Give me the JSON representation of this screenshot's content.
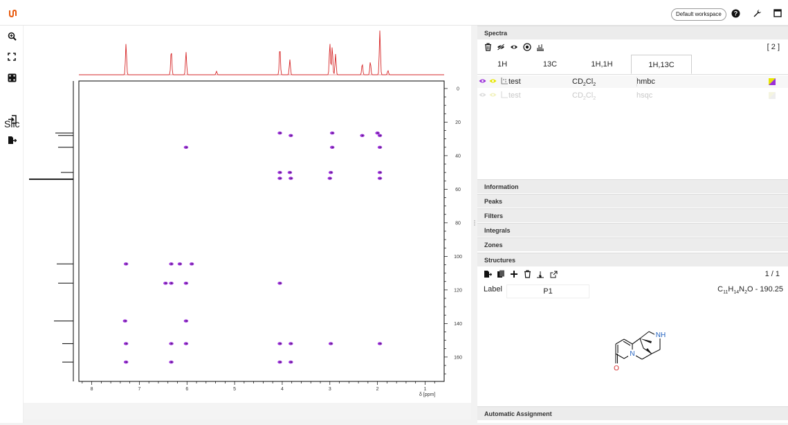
{
  "topbar": {
    "workspace_label": "Default workspace",
    "icons": [
      "help-icon",
      "wrench-icon",
      "maximize-icon"
    ]
  },
  "toolbar": {
    "slice_label": "Slic",
    "icons": [
      "zoom-icon",
      "full-view-icon",
      "dice-icon",
      "import-icon",
      "export-icon"
    ]
  },
  "colors": {
    "accent": "#e8590c",
    "spectrum_red": "#d62728",
    "contour_purple": "#9b30d9",
    "contour_yellow": "#e6e600",
    "nitrogen_blue": "#1f5fbf",
    "oxygen_red": "#d42a2a"
  },
  "spectra": {
    "header": "Spectra",
    "count": "[ 2 ]",
    "tabs": [
      {
        "label": "1H",
        "active": false
      },
      {
        "label": "13C",
        "active": false
      },
      {
        "label": "1H,1H",
        "active": false
      },
      {
        "label": "1H,13C",
        "active": true
      }
    ],
    "rows": [
      {
        "name": "test",
        "solvent": "CD",
        "sol_sub1": "2",
        "sol_mid": "Cl",
        "sol_sub2": "2",
        "experiment": "hmbc",
        "active": true
      },
      {
        "name": "test",
        "solvent": "CD",
        "sol_sub1": "2",
        "sol_mid": "Cl",
        "sol_sub2": "2",
        "experiment": "hsqc",
        "active": false
      }
    ]
  },
  "sections": {
    "information": "Information",
    "peaks": "Peaks",
    "filters": "Filters",
    "integrals": "Integrals",
    "zones": "Zones",
    "structures": "Structures",
    "automatic_assignment": "Automatic Assignment"
  },
  "structures": {
    "page": "1 / 1",
    "label_caption": "Label",
    "label_value": "P1",
    "formula_c": "C",
    "formula_c_n": "11",
    "formula_h": "H",
    "formula_h_n": "14",
    "formula_n": "N",
    "formula_n_n": "2",
    "formula_o": "O - 190.25",
    "atom_nh": "NH",
    "atom_n": "N",
    "atom_o": "O"
  },
  "plot": {
    "x_unit_label": "δ [ppm]",
    "x_ticks": [
      "8",
      "7",
      "6",
      "5",
      "4",
      "3",
      "2",
      "1"
    ],
    "y_ticks": [
      "0",
      "20",
      "40",
      "60",
      "80",
      "100",
      "120",
      "140",
      "160"
    ]
  },
  "chart_data": {
    "type": "scatter",
    "x_axis": {
      "label": "δ [ppm]",
      "range": [
        8.27,
        0.6
      ],
      "reversed": true
    },
    "y_axis": {
      "range": [
        -4.5,
        174.5
      ],
      "reversed": true
    },
    "f2_peaks": [
      7.28,
      6.33,
      6.02,
      5.38,
      4.05,
      3.84,
      3.0,
      2.95,
      2.88,
      2.32,
      2.15,
      1.95,
      1.78
    ],
    "f1_peaks": [
      26.5,
      28,
      35,
      50,
      54,
      104.5,
      116,
      138.5,
      152,
      163
    ],
    "cross_peaks": [
      {
        "x": 4.05,
        "y": 26.5
      },
      {
        "x": 3.82,
        "y": 28
      },
      {
        "x": 2.95,
        "y": 26.5
      },
      {
        "x": 2.32,
        "y": 28
      },
      {
        "x": 2.0,
        "y": 26.5
      },
      {
        "x": 1.95,
        "y": 28
      },
      {
        "x": 6.02,
        "y": 35
      },
      {
        "x": 2.95,
        "y": 35
      },
      {
        "x": 1.95,
        "y": 35
      },
      {
        "x": 4.05,
        "y": 50
      },
      {
        "x": 3.84,
        "y": 50
      },
      {
        "x": 2.98,
        "y": 50
      },
      {
        "x": 1.95,
        "y": 50
      },
      {
        "x": 4.05,
        "y": 53.5
      },
      {
        "x": 3.82,
        "y": 53.5
      },
      {
        "x": 3.0,
        "y": 53.5
      },
      {
        "x": 1.95,
        "y": 53.5
      },
      {
        "x": 7.28,
        "y": 104.5
      },
      {
        "x": 6.33,
        "y": 104.5
      },
      {
        "x": 6.15,
        "y": 104.5
      },
      {
        "x": 5.9,
        "y": 104.5
      },
      {
        "x": 6.45,
        "y": 116
      },
      {
        "x": 6.33,
        "y": 116
      },
      {
        "x": 6.02,
        "y": 116
      },
      {
        "x": 4.05,
        "y": 116
      },
      {
        "x": 7.3,
        "y": 138.5
      },
      {
        "x": 6.02,
        "y": 138.5
      },
      {
        "x": 7.28,
        "y": 152
      },
      {
        "x": 6.33,
        "y": 152
      },
      {
        "x": 6.02,
        "y": 152
      },
      {
        "x": 4.05,
        "y": 152
      },
      {
        "x": 3.82,
        "y": 152
      },
      {
        "x": 2.98,
        "y": 152
      },
      {
        "x": 1.95,
        "y": 152
      },
      {
        "x": 7.28,
        "y": 163
      },
      {
        "x": 6.33,
        "y": 163
      },
      {
        "x": 4.05,
        "y": 163
      },
      {
        "x": 3.82,
        "y": 163
      }
    ]
  }
}
